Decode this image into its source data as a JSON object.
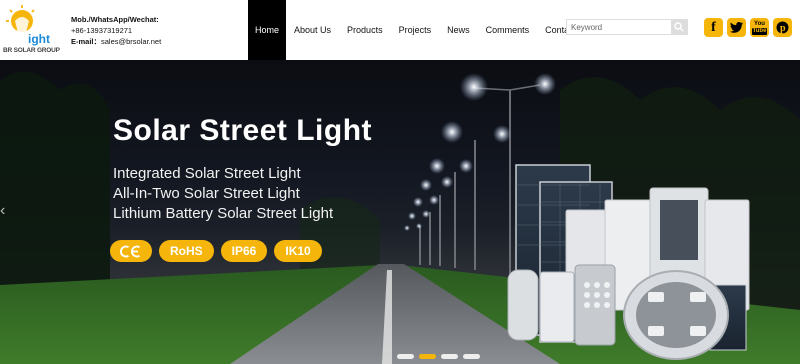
{
  "brand": {
    "logo_text": "BR SOLAR GROUP",
    "logo_word": "ight"
  },
  "contact": {
    "phone_label": "Mob./WhatsApp/Wechat:",
    "phone": "+86-13937319271",
    "email_label": "E-mail：",
    "email": "sales@brsolar.net"
  },
  "nav": {
    "items": [
      {
        "label": "Home",
        "active": true
      },
      {
        "label": "About Us"
      },
      {
        "label": "Products"
      },
      {
        "label": "Projects"
      },
      {
        "label": "News"
      },
      {
        "label": "Comments"
      },
      {
        "label": "Contact Us"
      }
    ]
  },
  "search": {
    "placeholder": "Keyword"
  },
  "socials": [
    {
      "icon": "facebook-icon",
      "glyph": "f"
    },
    {
      "icon": "twitter-icon",
      "glyph": "t"
    },
    {
      "icon": "youtube-icon",
      "glyph": "You"
    },
    {
      "icon": "pinterest-icon",
      "glyph": "P"
    }
  ],
  "hero": {
    "title": "Solar Street Light",
    "lines": [
      "Integrated Solar Street Light",
      "All-In-Two Solar Street Light",
      "Lithium Battery Solar Street Light"
    ],
    "badges": [
      "CE",
      "RoHS",
      "IP66",
      "IK10"
    ],
    "slides": 4,
    "active_slide": 1
  },
  "colors": {
    "accent": "#f5b50a",
    "nav_active_bg": "#000000"
  }
}
